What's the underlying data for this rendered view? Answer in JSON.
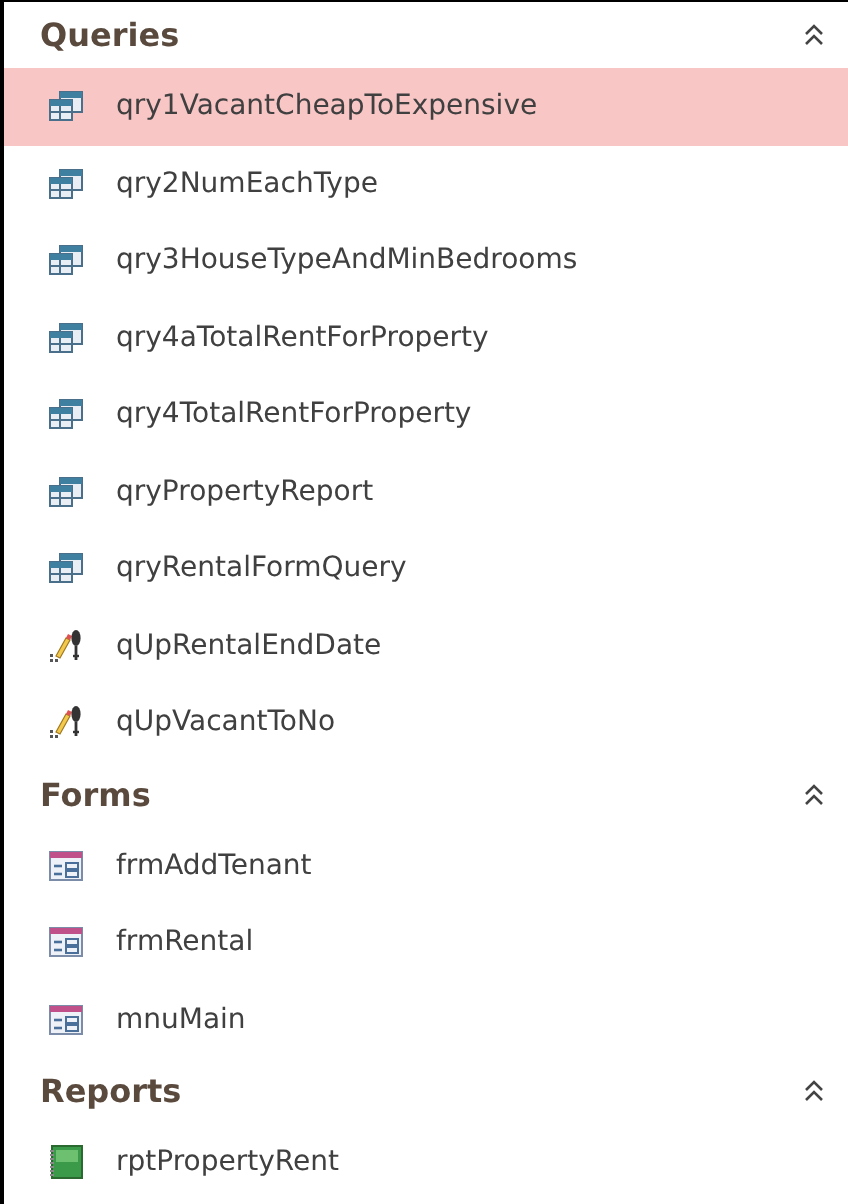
{
  "groups": [
    {
      "title": "Queries",
      "expanded": true,
      "items": [
        {
          "label": "qry1VacantCheapToExpensive",
          "kind": "query",
          "selected": true
        },
        {
          "label": "qry2NumEachType",
          "kind": "query",
          "selected": false
        },
        {
          "label": "qry3HouseTypeAndMinBedrooms",
          "kind": "query",
          "selected": false
        },
        {
          "label": "qry4aTotalRentForProperty",
          "kind": "query",
          "selected": false
        },
        {
          "label": "qry4TotalRentForProperty",
          "kind": "query",
          "selected": false
        },
        {
          "label": "qryPropertyReport",
          "kind": "query",
          "selected": false
        },
        {
          "label": "qryRentalFormQuery",
          "kind": "query",
          "selected": false
        },
        {
          "label": "qUpRentalEndDate",
          "kind": "update",
          "selected": false
        },
        {
          "label": "qUpVacantToNo",
          "kind": "update",
          "selected": false
        }
      ]
    },
    {
      "title": "Forms",
      "expanded": true,
      "items": [
        {
          "label": "frmAddTenant",
          "kind": "form",
          "selected": false
        },
        {
          "label": "frmRental",
          "kind": "form",
          "selected": false
        },
        {
          "label": "mnuMain",
          "kind": "form",
          "selected": false
        }
      ]
    },
    {
      "title": "Reports",
      "expanded": true,
      "items": [
        {
          "label": "rptPropertyRent",
          "kind": "report",
          "selected": false
        }
      ]
    }
  ]
}
